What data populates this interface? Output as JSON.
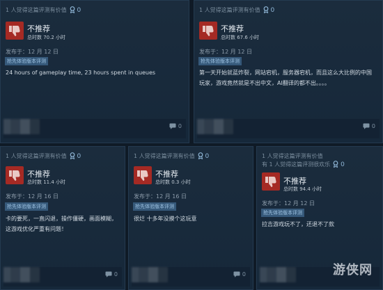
{
  "reviews": [
    {
      "helpful": "1 人觉得这篇评测有价值",
      "awards": "0",
      "verdict": "不推荐",
      "hours": "总时数 70.2 小时",
      "posted": "发布于：12 月 12 日",
      "tag": "抢先体验版本评测",
      "text": "24 hours of gameplay time, 23 hours spent in queues",
      "comments": "0"
    },
    {
      "helpful": "1 人觉得这篇评测有价值",
      "awards": "0",
      "verdict": "不推荐",
      "hours": "总时数 67.6 小时",
      "posted": "发布于：12 月 12 日",
      "tag": "抢先体验版本评测",
      "text": "第一天开始就蓝炸裂，网站宕机，服务器宕机，而且这么大比例的中国玩家，游戏竟然就是不出中文，AI翻译的都不出。。。。",
      "comments": "0"
    },
    {
      "helpful": "1 人觉得这篇评测有价值",
      "awards": "0",
      "verdict": "不推荐",
      "hours": "总时数 11.4 小时",
      "posted": "发布于：12 月 16 日",
      "tag": "抢先体验版本评测",
      "text": "卡的要死，一直闪退，操作僵硬，画面模糊，这游戏优化严重有问题！",
      "comments": "0"
    },
    {
      "helpful": "1 人觉得这篇评测有价值",
      "awards": "0",
      "verdict": "不推荐",
      "hours": "总时数 0.3 小时",
      "posted": "发布于：12 月 16 日",
      "tag": "抢先体验版本评测",
      "text": "很烂 十多年没摸个这玩意",
      "comments": "0"
    },
    {
      "helpful": "1 人觉得这篇评测有价值",
      "helpful_funny": "有 1 人觉得这篇评测很欢乐",
      "awards": "0",
      "verdict": "不推荐",
      "hours": "总时数 94.4 小时",
      "posted": "发布于：12 月 12 日",
      "tag": "抢先体验版本评测",
      "text": "拉吉游戏玩不了，还退不了款",
      "comments": "0"
    }
  ],
  "watermark": "游侠网",
  "colors": {
    "thumb_red": "#a52a24",
    "tag_bg": "#36597a",
    "page_bg": "#0f1a26"
  },
  "icons": {
    "verdict": "thumbs-down-icon",
    "award": "award-ribbon-icon",
    "comments": "comment-bubble-icon"
  }
}
